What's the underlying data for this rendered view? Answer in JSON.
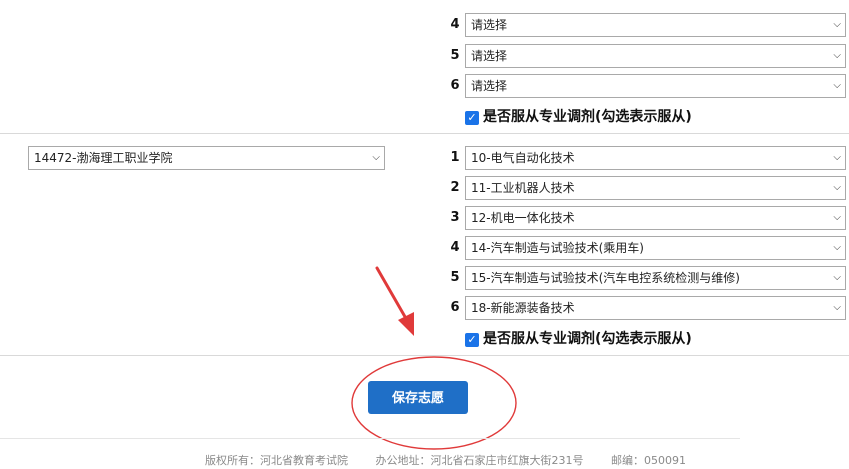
{
  "placeholder_option": "请选择",
  "group1": {
    "rows": [
      {
        "num": "4",
        "value": "请选择"
      },
      {
        "num": "5",
        "value": "请选择"
      },
      {
        "num": "6",
        "value": "请选择"
      }
    ],
    "adjust_label": "是否服从专业调剂(勾选表示服从)",
    "adjust_checked": true
  },
  "group2": {
    "school": "14472-渤海理工职业学院",
    "rows": [
      {
        "num": "1",
        "value": "10-电气自动化技术"
      },
      {
        "num": "2",
        "value": "11-工业机器人技术"
      },
      {
        "num": "3",
        "value": "12-机电一体化技术"
      },
      {
        "num": "4",
        "value": "14-汽车制造与试验技术(乘用车)"
      },
      {
        "num": "5",
        "value": "15-汽车制造与试验技术(汽车电控系统检测与维修)"
      },
      {
        "num": "6",
        "value": "18-新能源装备技术"
      }
    ],
    "adjust_label": "是否服从专业调剂(勾选表示服从)",
    "adjust_checked": true
  },
  "save_button": "保存志愿",
  "footer": {
    "copyright": "版权所有：河北省教育考试院",
    "address": "办公地址：河北省石家庄市红旗大街231号",
    "postcode": "邮编：050091"
  },
  "colors": {
    "button": "#1f6fc7",
    "checkbox": "#1a73e8",
    "annotation": "#e03a3a"
  },
  "icons": [
    "chevron-down-icon",
    "checkmark-icon",
    "annotation-arrow",
    "annotation-circle"
  ]
}
